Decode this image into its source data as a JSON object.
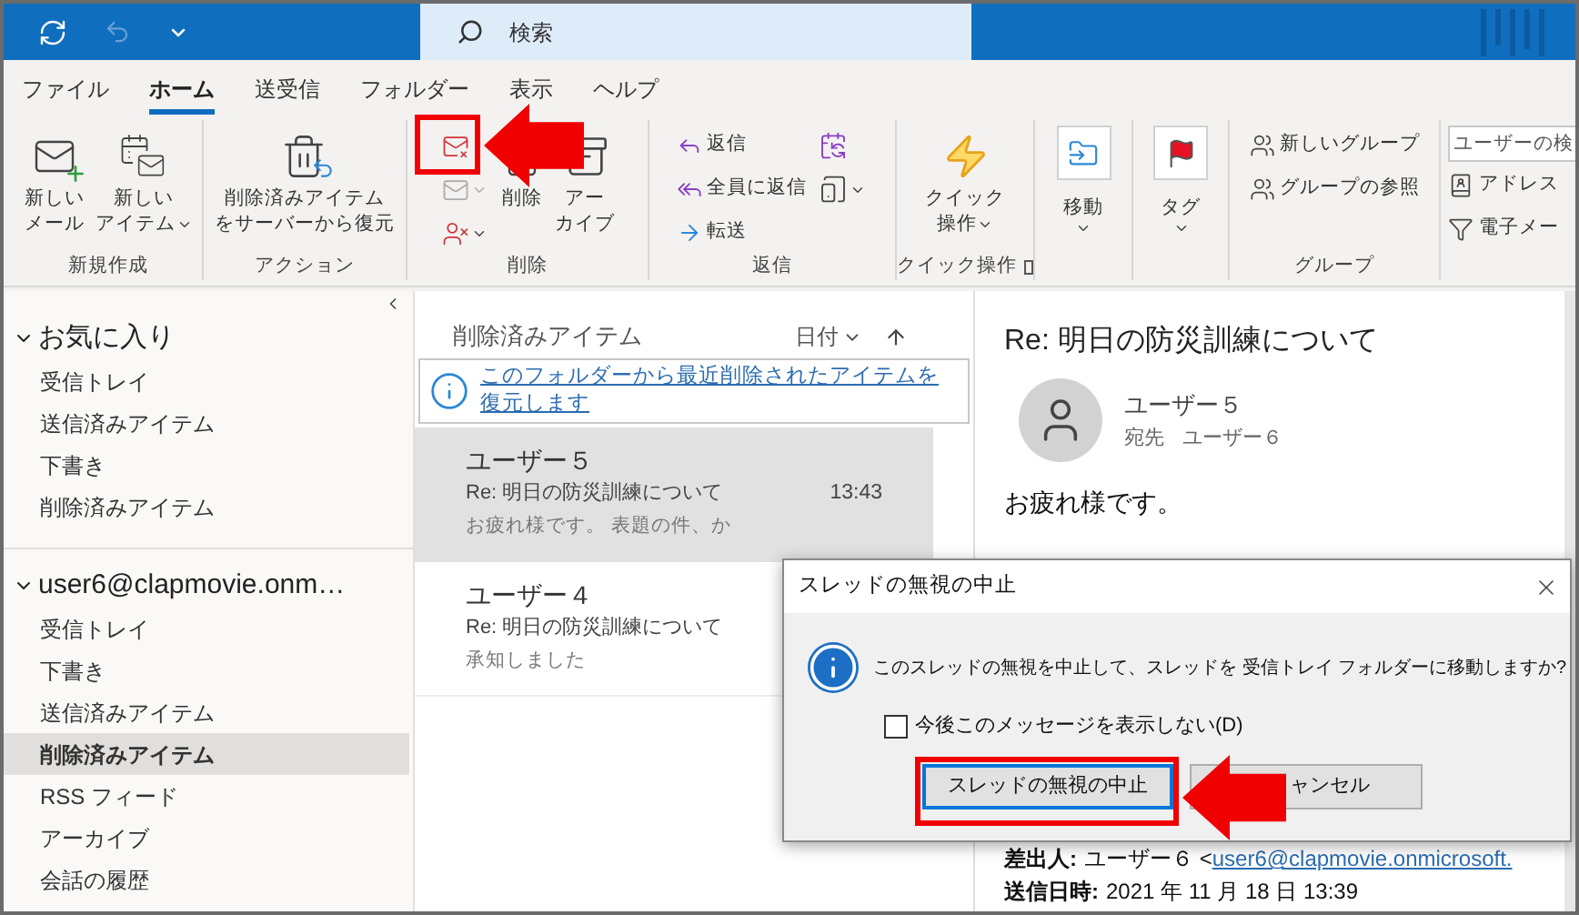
{
  "title_bar": {
    "search": {
      "placeholder": "検索"
    }
  },
  "menu_tabs": [
    {
      "label": "ファイル",
      "selected": false
    },
    {
      "label": "ホーム",
      "selected": true
    },
    {
      "label": "送受信",
      "selected": false
    },
    {
      "label": "フォルダー",
      "selected": false
    },
    {
      "label": "表示",
      "selected": false
    },
    {
      "label": "ヘルプ",
      "selected": false
    }
  ],
  "ribbon": [
    {
      "label": "新規作成",
      "items": [
        {
          "kind": "large",
          "lines": [
            "新しい",
            "メール"
          ],
          "dropdown": false
        },
        {
          "kind": "large",
          "lines": [
            "新しい",
            "アイテム"
          ],
          "dropdown": true
        }
      ]
    },
    {
      "label": "アクション",
      "items": [
        {
          "kind": "large",
          "lines": [
            "削除済みアイテム",
            "をサーバーから復元"
          ],
          "dropdown": false
        }
      ]
    },
    {
      "label": "削除",
      "items": [
        {
          "kind": "column",
          "entries": [
            {
              "kind": "icon",
              "disabled": false,
              "dropdown": false
            },
            {
              "kind": "icon",
              "disabled": true,
              "dropdown": true
            },
            {
              "kind": "icon",
              "disabled": false,
              "dropdown": true
            }
          ]
        },
        {
          "kind": "large",
          "lines": [
            "削除"
          ],
          "dropdown": false
        },
        {
          "kind": "large",
          "lines": [
            "アー",
            "カイブ"
          ],
          "dropdown": false
        }
      ]
    },
    {
      "label": "返信",
      "items": [
        {
          "kind": "column",
          "entries": [
            {
              "kind": "small",
              "label": "返信",
              "dropdown": false
            },
            {
              "kind": "small",
              "label": "全員に返信",
              "dropdown": false
            },
            {
              "kind": "small",
              "label": "転送",
              "dropdown": false
            }
          ]
        },
        {
          "kind": "column",
          "entries": [
            {
              "kind": "icon",
              "disabled": false,
              "dropdown": false
            },
            {
              "kind": "icon",
              "disabled": false,
              "dropdown": true
            }
          ]
        }
      ]
    },
    {
      "label": "クイック操作",
      "launcher": true,
      "items": [
        {
          "kind": "large",
          "lines": [
            "クイック",
            "操作"
          ],
          "dropdown": true
        }
      ]
    },
    {
      "items": [
        {
          "kind": "boxed",
          "lines": [
            "移動"
          ],
          "dropdown": true
        }
      ]
    },
    {
      "items": [
        {
          "kind": "boxed",
          "lines": [
            "タグ"
          ],
          "dropdown": true
        }
      ]
    },
    {
      "label": "グループ",
      "items": [
        {
          "kind": "column",
          "entries": [
            {
              "kind": "small",
              "label": "新しいグループ",
              "dropdown": false
            },
            {
              "kind": "small",
              "label": "グループの参照",
              "dropdown": false
            }
          ]
        }
      ]
    },
    {
      "items": [
        {
          "kind": "column",
          "entries": [
            {
              "kind": "search",
              "placeholder": "ユーザーの検"
            },
            {
              "kind": "small",
              "label": "アドレス",
              "dropdown": false
            },
            {
              "kind": "small",
              "label": "電子メー",
              "dropdown": false
            }
          ]
        }
      ]
    }
  ],
  "nav": [
    {
      "label": "お気に入り",
      "expanded": true,
      "folders": [
        {
          "label": "受信トレイ",
          "selected": false
        },
        {
          "label": "送信済みアイテム",
          "selected": false
        },
        {
          "label": "下書き",
          "selected": false
        },
        {
          "label": "削除済みアイテム",
          "selected": false
        }
      ]
    },
    {
      "label": "user6@clapmovie.onm…",
      "expanded": true,
      "folders": [
        {
          "label": "受信トレイ",
          "selected": false
        },
        {
          "label": "下書き",
          "selected": false
        },
        {
          "label": "送信済みアイテム",
          "selected": false
        },
        {
          "label": "削除済みアイテム",
          "selected": true
        },
        {
          "label": "RSS フィード",
          "selected": false
        },
        {
          "label": "アーカイブ",
          "selected": false
        },
        {
          "label": "会話の履歴",
          "selected": false
        }
      ]
    }
  ],
  "message_list": {
    "folder": "削除済みアイテム",
    "sort": "日付",
    "info_link": "このフォルダーから最近削除されたアイテムを復元します",
    "messages": [
      {
        "sender": "ユーザー５",
        "subject": "Re: 明日の防災訓練について",
        "time": "13:43",
        "preview": "お疲れ様です。 表題の件、か",
        "selected": true
      },
      {
        "sender": "ユーザー４",
        "subject": "Re: 明日の防災訓練について",
        "preview": "承知しました",
        "selected": false
      }
    ]
  },
  "reading_pane": {
    "subject": "Re: 明日の防災訓練について",
    "sender": "ユーザー５",
    "to_label": "宛先",
    "to": "ユーザー６",
    "greeting": "お疲れ様です。",
    "from_label": "差出人:",
    "from_name": "ユーザー６ <",
    "from_email": "user6@clapmovie.onmicrosoft.",
    "sent_label": "送信日時:",
    "sent": "2021 年 11 月 18 日 13:39"
  },
  "dialog": {
    "title": "スレッドの無視の中止",
    "message": "このスレッドの無視を中止して、スレッドを 受信トレイ フォルダーに移動しますか?",
    "checkbox": {
      "label": "今後このメッセージを表示しない(D)",
      "checked": false
    },
    "buttons": [
      {
        "label": "スレッドの無視の中止",
        "default": true
      },
      {
        "label": "ャンセル",
        "default": false
      }
    ]
  }
}
